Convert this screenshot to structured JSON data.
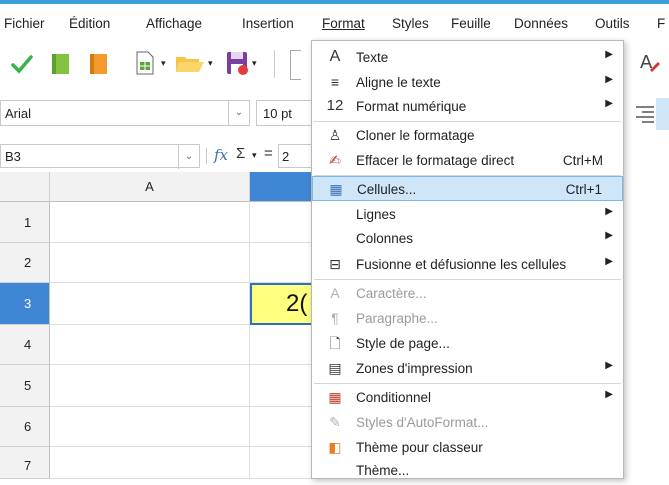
{
  "menubar": {
    "items": [
      "Fichier",
      "Édition",
      "Affichage",
      "Insertion",
      "Format",
      "Styles",
      "Feuille",
      "Données",
      "Outils",
      "F"
    ]
  },
  "formatbar": {
    "font_name": "Arial",
    "font_size": "10 pt"
  },
  "namebox": {
    "value": "B3",
    "fx": "fx",
    "sigma": "Σ",
    "equals": "=",
    "formula_partial": "2"
  },
  "grid": {
    "columns": [
      "A"
    ],
    "rows": [
      "1",
      "2",
      "3",
      "4",
      "5",
      "6",
      "7"
    ],
    "selected_cell_value_partial": "2("
  },
  "format_menu": {
    "items": [
      {
        "icon": "text-A-icon",
        "label": "Texte",
        "shortcut": "",
        "submenu": true,
        "disabled": false
      },
      {
        "icon": "align-icon",
        "label": "Aligne le texte",
        "shortcut": "",
        "submenu": true,
        "disabled": false
      },
      {
        "icon": "number-format-icon",
        "label": "Format numérique",
        "shortcut": "",
        "submenu": true,
        "disabled": false
      },
      {
        "icon": "clone-format-icon",
        "label": "Cloner le formatage",
        "shortcut": "",
        "submenu": false,
        "disabled": false
      },
      {
        "icon": "clear-format-icon",
        "label": "Effacer le formatage direct",
        "shortcut": "Ctrl+M",
        "submenu": false,
        "disabled": false
      },
      {
        "icon": "cells-icon",
        "label": "Cellules...",
        "shortcut": "Ctrl+1",
        "submenu": false,
        "disabled": false,
        "highlighted": true
      },
      {
        "icon": "",
        "label": "Lignes",
        "shortcut": "",
        "submenu": true,
        "disabled": false
      },
      {
        "icon": "",
        "label": "Colonnes",
        "shortcut": "",
        "submenu": true,
        "disabled": false
      },
      {
        "icon": "merge-cells-icon",
        "label": "Fusionne et défusionne les cellules",
        "shortcut": "",
        "submenu": true,
        "disabled": false
      },
      {
        "icon": "character-icon",
        "label": "Caractère...",
        "shortcut": "",
        "submenu": false,
        "disabled": true
      },
      {
        "icon": "paragraph-icon",
        "label": "Paragraphe...",
        "shortcut": "",
        "submenu": false,
        "disabled": true
      },
      {
        "icon": "page-style-icon",
        "label": "Style de page...",
        "shortcut": "",
        "submenu": false,
        "disabled": false
      },
      {
        "icon": "print-ranges-icon",
        "label": "Zones d'impression",
        "shortcut": "",
        "submenu": true,
        "disabled": false
      },
      {
        "icon": "conditional-icon",
        "label": "Conditionnel",
        "shortcut": "",
        "submenu": true,
        "disabled": false
      },
      {
        "icon": "autoformat-icon",
        "label": "Styles d'AutoFormat...",
        "shortcut": "",
        "submenu": false,
        "disabled": true
      },
      {
        "icon": "theme-icon",
        "label": "Thème pour classeur",
        "shortcut": "",
        "submenu": false,
        "disabled": false
      },
      {
        "icon": "",
        "label": "Thème...",
        "shortcut": "",
        "submenu": false,
        "disabled": false
      }
    ]
  },
  "colors": {
    "accent": "#3aa0d8",
    "selection_highlight": "#cfe6f8",
    "selected_cell": "#ffff80",
    "selected_header": "#3f86d4"
  }
}
